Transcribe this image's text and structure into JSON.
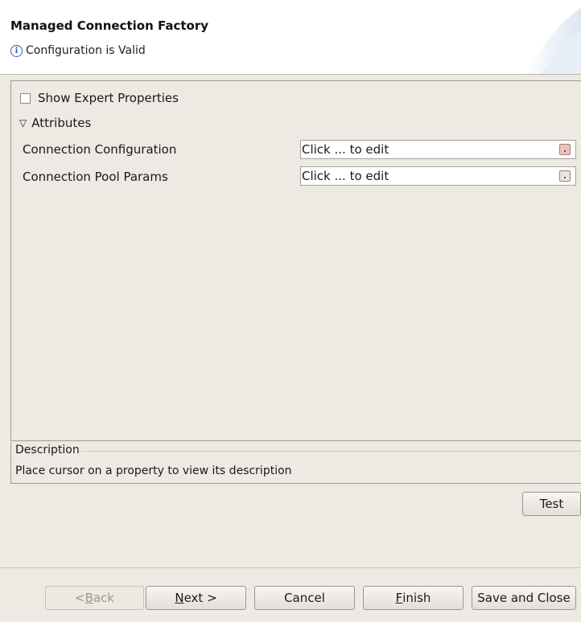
{
  "header": {
    "title": "Managed Connection Factory",
    "message": "Configuration is Valid",
    "message_icon": "info-icon"
  },
  "options": {
    "show_expert_label": "Show Expert Properties",
    "show_expert_checked": false
  },
  "attributes": {
    "section_label": "Attributes",
    "expanded": true,
    "rows": [
      {
        "label": "Connection Configuration",
        "value": "Click ... to edit"
      },
      {
        "label": "Connection Pool Params",
        "value": "Click ... to edit"
      }
    ]
  },
  "description": {
    "legend": "Description",
    "text": "Place cursor on a property to view its description"
  },
  "buttons": {
    "test": "Test",
    "back_prefix": "< ",
    "back_mnemonic": "B",
    "back_rest": "ack",
    "next_mnemonic": "N",
    "next_rest": "ext >",
    "cancel": "Cancel",
    "finish_mnemonic": "F",
    "finish_rest": "inish",
    "save_close": "Save and Close"
  }
}
